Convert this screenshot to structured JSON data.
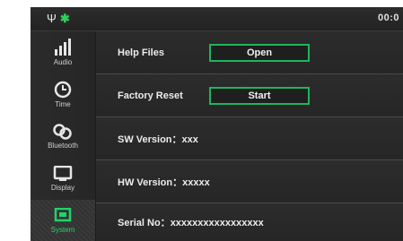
{
  "status": {
    "clock": "00:0",
    "icons": [
      "antenna-icon",
      "bluetooth-icon"
    ]
  },
  "sidebar": {
    "items": [
      {
        "label": "Audio",
        "icon": "equalizer-icon"
      },
      {
        "label": "Time",
        "icon": "clock-icon"
      },
      {
        "label": "Bluetooth",
        "icon": "bluetooth-link-icon"
      },
      {
        "label": "Display",
        "icon": "display-icon"
      },
      {
        "label": "System",
        "icon": "system-icon",
        "active": true
      }
    ]
  },
  "settings": {
    "help_files": {
      "label": "Help Files",
      "button": "Open"
    },
    "factory_reset": {
      "label": "Factory Reset",
      "button": "Start"
    },
    "sw_version": {
      "label": "SW Version：",
      "value": "xxx"
    },
    "hw_version": {
      "label": "HW Version：",
      "value": "xxxxx"
    },
    "serial_no": {
      "label": "Serial No：",
      "value": "xxxxxxxxxxxxxxxxx"
    }
  },
  "colors": {
    "accent": "#1eb55c",
    "background": "#2a2a2a",
    "text": "#ececec"
  }
}
